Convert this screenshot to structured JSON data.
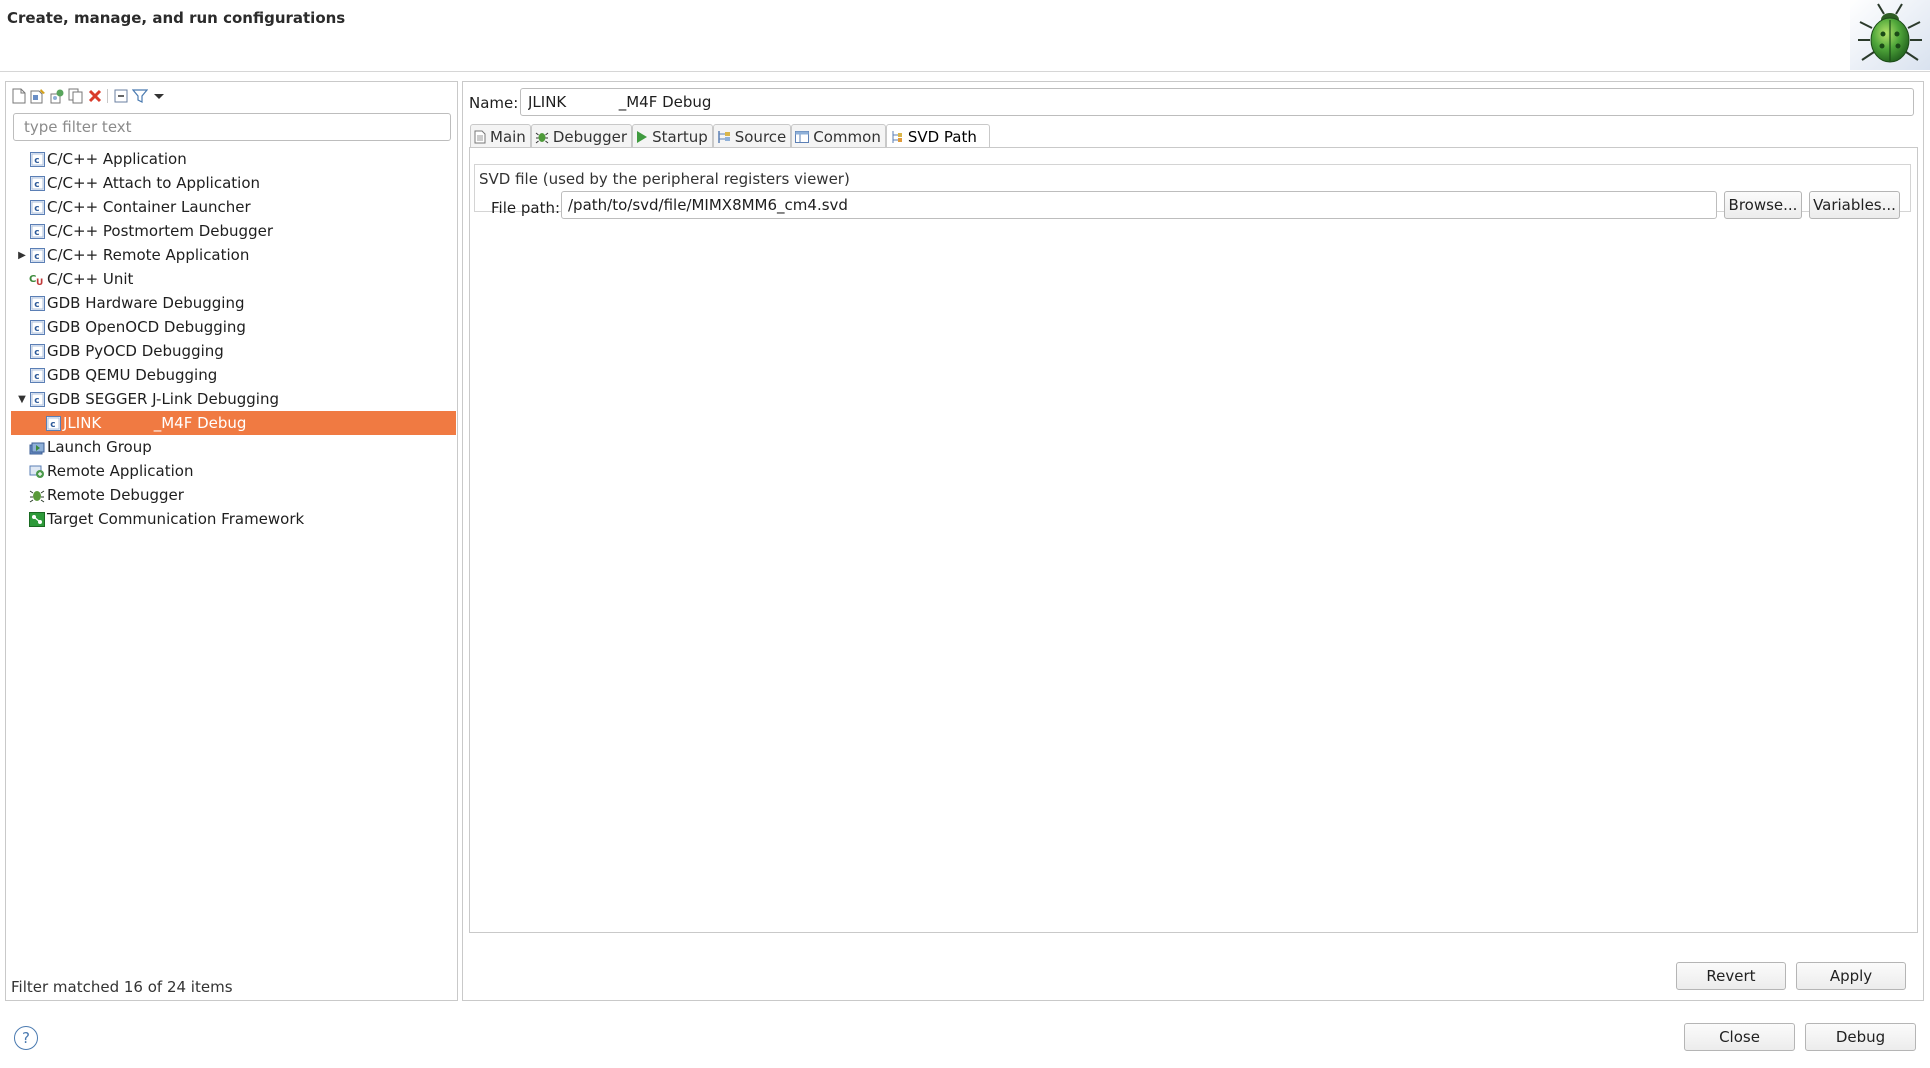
{
  "header": {
    "title": "Create, manage, and run configurations"
  },
  "toolbar": {
    "icons": [
      "new-config-icon",
      "new-prototype-icon",
      "export-icon",
      "duplicate-icon",
      "delete-icon",
      "collapse-all-icon",
      "filter-icon",
      "view-menu-icon"
    ]
  },
  "filter": {
    "placeholder": "type filter text",
    "value": ""
  },
  "tree": {
    "items": [
      {
        "label": "C/C++ Application",
        "icon": "c-app-icon",
        "expander": ""
      },
      {
        "label": "C/C++ Attach to Application",
        "icon": "c-app-icon",
        "expander": ""
      },
      {
        "label": "C/C++ Container Launcher",
        "icon": "c-app-icon",
        "expander": ""
      },
      {
        "label": "C/C++ Postmortem Debugger",
        "icon": "c-app-icon",
        "expander": ""
      },
      {
        "label": "C/C++ Remote Application",
        "icon": "c-app-icon",
        "expander": "▶"
      },
      {
        "label": "C/C++ Unit",
        "icon": "c-unit-icon",
        "expander": ""
      },
      {
        "label": "GDB Hardware Debugging",
        "icon": "c-app-icon",
        "expander": ""
      },
      {
        "label": "GDB OpenOCD Debugging",
        "icon": "c-app-icon",
        "expander": ""
      },
      {
        "label": "GDB PyOCD Debugging",
        "icon": "c-app-icon",
        "expander": ""
      },
      {
        "label": "GDB QEMU Debugging",
        "icon": "c-app-icon",
        "expander": ""
      },
      {
        "label": "GDB SEGGER J-Link Debugging",
        "icon": "c-app-icon",
        "expander": "▼"
      },
      {
        "label": "JLINK           _M4F Debug",
        "icon": "c-app-icon",
        "expander": "",
        "child": true,
        "selected": true
      },
      {
        "label": "Launch Group",
        "icon": "launch-group-icon",
        "expander": ""
      },
      {
        "label": "Remote Application",
        "icon": "remote-app-icon",
        "expander": ""
      },
      {
        "label": "Remote Debugger",
        "icon": "remote-debugger-icon",
        "expander": ""
      },
      {
        "label": "Target Communication Framework",
        "icon": "tcf-icon",
        "expander": ""
      }
    ]
  },
  "status": {
    "filter_matched": "Filter matched 16 of 24 items"
  },
  "config": {
    "name_label": "Name:",
    "name_value": "JLINK           _M4F Debug"
  },
  "tabs": [
    {
      "label": "Main",
      "icon": "main-tab-icon",
      "active": false
    },
    {
      "label": "Debugger",
      "icon": "debugger-tab-icon",
      "active": false
    },
    {
      "label": "Startup",
      "icon": "startup-tab-icon",
      "active": false
    },
    {
      "label": "Source",
      "icon": "source-tab-icon",
      "active": false
    },
    {
      "label": "Common",
      "icon": "common-tab-icon",
      "active": false
    },
    {
      "label": "SVD Path",
      "icon": "svd-path-tab-icon",
      "active": true
    }
  ],
  "svd": {
    "group_title": "SVD file (used by the peripheral registers viewer)",
    "file_path_label": "File path:",
    "file_path_value": "/path/to/svd/file/MIMX8MM6_cm4.svd",
    "browse_label": "Browse...",
    "variables_label": "Variables..."
  },
  "actions": {
    "revert_label": "Revert",
    "apply_label": "Apply",
    "close_label": "Close",
    "debug_label": "Debug",
    "help_label": "?"
  }
}
